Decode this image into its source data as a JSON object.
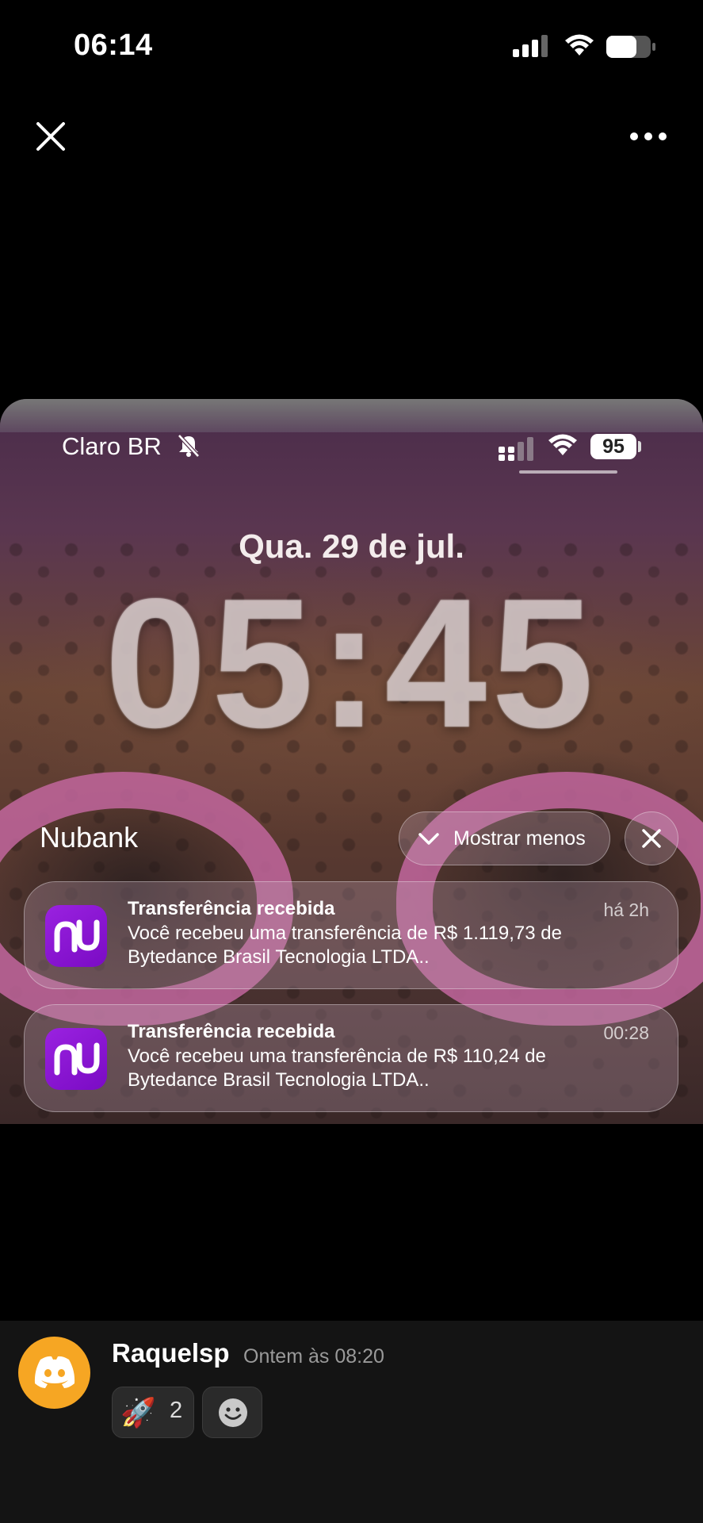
{
  "status_bar": {
    "time": "06:14",
    "signal_icon": "cellular-signal-icon",
    "wifi_icon": "wifi-icon",
    "battery_icon": "battery-icon"
  },
  "viewer": {
    "close_icon": "close-icon",
    "more_icon": "more-horizontal-icon"
  },
  "lock_screen": {
    "carrier": "Claro BR",
    "silent_icon": "bell-slash-icon",
    "battery_level": "95",
    "date": "Qua. 29 de jul.",
    "time": "05:45",
    "app_group": "Nubank",
    "collapse_label": "Mostrar menos",
    "clear_icon": "close-icon",
    "notifications": [
      {
        "app_icon": "nubank-icon",
        "title": "Transferência recebida",
        "time": "há 2h",
        "body": "Você recebeu uma transferência de R$ 1.119,73 de Bytedance Brasil Tecnologia LTDA.."
      },
      {
        "app_icon": "nubank-icon",
        "title": "Transferência recebida",
        "time": "00:28",
        "body": "Você recebeu uma transferência de R$ 110,24 de Bytedance Brasil Tecnologia LTDA.."
      }
    ]
  },
  "message": {
    "avatar_icon": "discord-icon",
    "username": "Raquelsp",
    "timestamp": "Ontem às 08:20",
    "reactions": [
      {
        "emoji": "🚀",
        "count": "2"
      }
    ],
    "add_reaction_icon": "add-reaction-icon"
  },
  "colors": {
    "avatar_bg": "#f6a623",
    "nubank_purple": "#820ad1",
    "sunglasses_pink": "#c2669e",
    "message_bar_bg": "#141414"
  }
}
